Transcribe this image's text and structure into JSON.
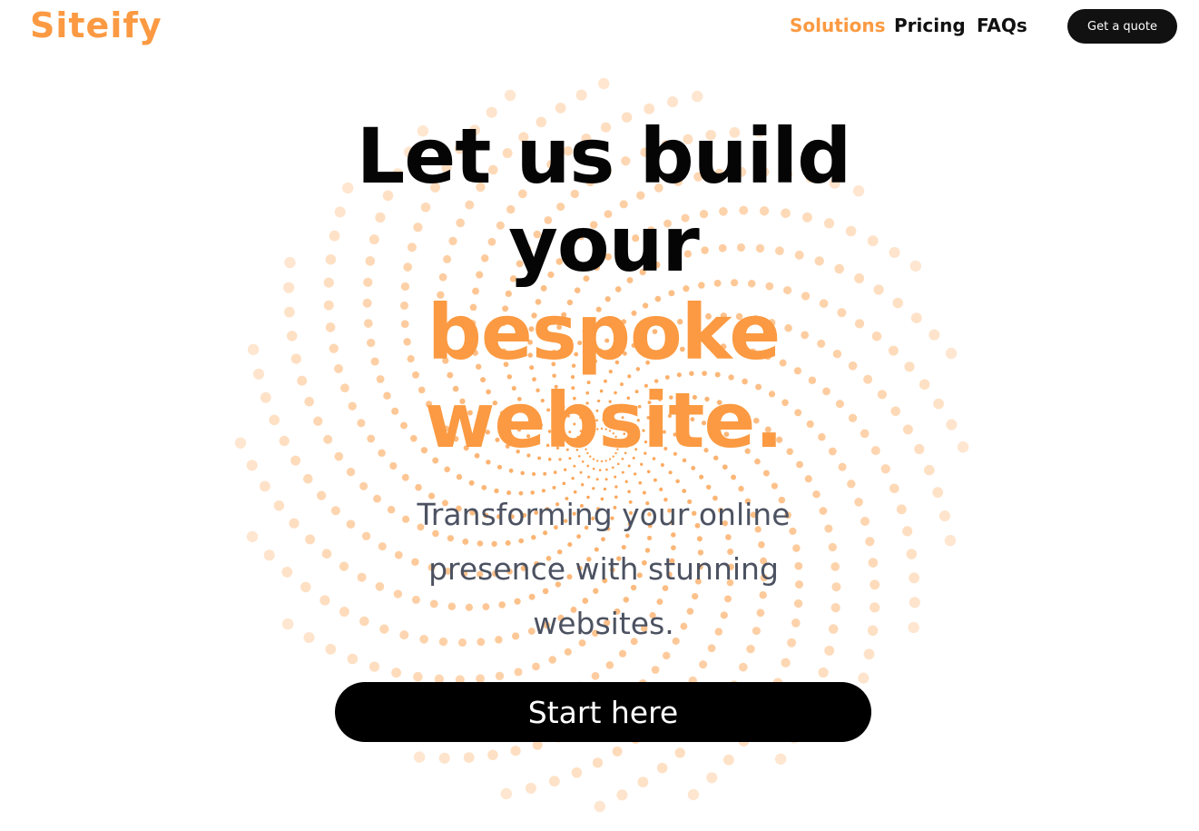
{
  "brand": {
    "name": "Siteify",
    "accent_color": "#fb9a42",
    "dark_color": "#000000",
    "text_muted_color": "#4c5261"
  },
  "nav": {
    "items": [
      {
        "label": "Solutions",
        "active": true
      },
      {
        "label": "Pricing",
        "active": false
      },
      {
        "label": "FAQs",
        "active": false
      }
    ],
    "cta_label": "Get a quote"
  },
  "hero": {
    "title_lines": [
      "Let us build",
      "your"
    ],
    "title_accent_lines": [
      "bespoke",
      "website."
    ],
    "subtitle": "Transforming your online presence with stunning websites.",
    "cta_label": "Start here"
  },
  "background": {
    "decoration": "spiral-dots"
  }
}
